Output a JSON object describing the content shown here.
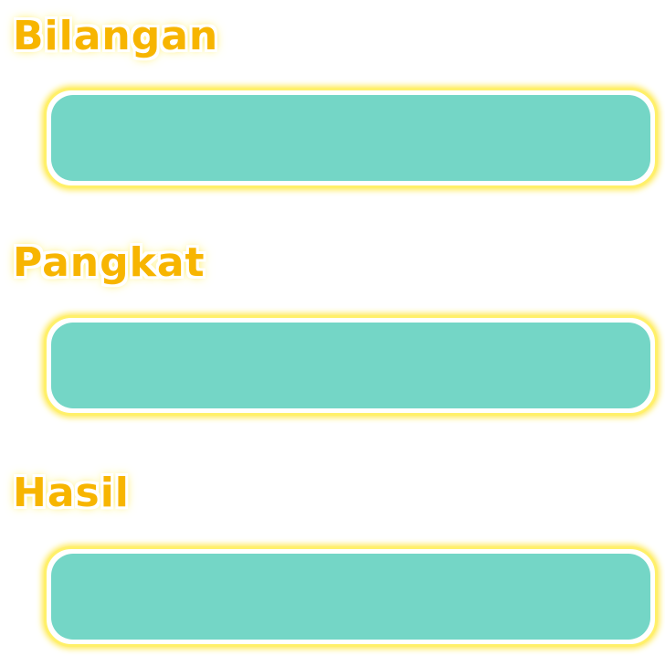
{
  "form": {
    "bilangan": {
      "label": "Bilangan",
      "value": ""
    },
    "pangkat": {
      "label": "Pangkat",
      "value": ""
    },
    "hasil": {
      "label": "Hasil",
      "value": ""
    }
  },
  "colors": {
    "label_text": "#f7b500",
    "label_glow": "#ffe94d",
    "field_fill": "#74d6c6",
    "field_border": "#fff06a",
    "background": "#ffffff"
  }
}
